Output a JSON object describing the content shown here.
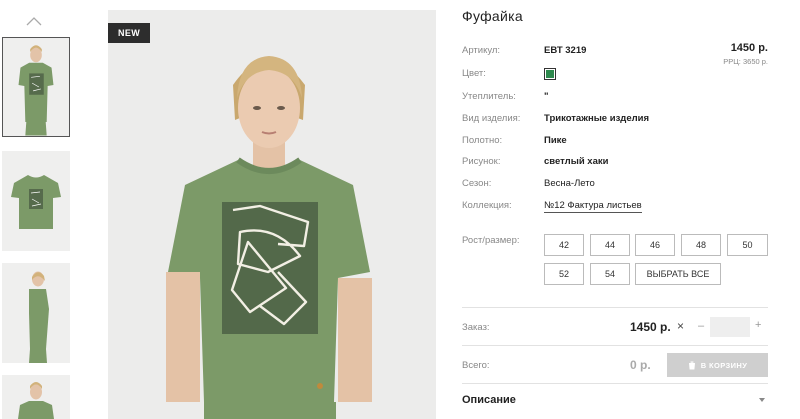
{
  "badge": "NEW",
  "product": {
    "title": "Фуфайка",
    "price": "1450 р.",
    "rrp": "РРЦ: 3650 р.",
    "color_hex": "#2e8a4e"
  },
  "specs": [
    {
      "label": "Артикул:",
      "value": "ЕВТ 3219"
    },
    {
      "label": "Цвет:",
      "value": ""
    },
    {
      "label": "Утеплитель:",
      "value": "\""
    },
    {
      "label": "Вид изделия:",
      "value": "Трикотажные изделия"
    },
    {
      "label": "Полотно:",
      "value": "Пике"
    },
    {
      "label": "Рисунок:",
      "value": "светлый хаки"
    },
    {
      "label": "Сезон:",
      "value": "Весна-Лето"
    },
    {
      "label": "Коллекция:",
      "value": "№12 Фактура листьев"
    }
  ],
  "sizes": {
    "label": "Рост/размер:",
    "options": [
      "42",
      "44",
      "46",
      "48",
      "50",
      "52",
      "54"
    ],
    "select_all": "ВЫБРАТЬ ВСЕ"
  },
  "order": {
    "label": "Заказ:",
    "price": "1450 р.",
    "times": "×",
    "minus": "–",
    "plus": "+",
    "qty": ""
  },
  "total": {
    "label": "Всего:",
    "value": "0 р.",
    "cart_button": "В КОРЗИНУ"
  },
  "description": {
    "label": "Описание"
  }
}
